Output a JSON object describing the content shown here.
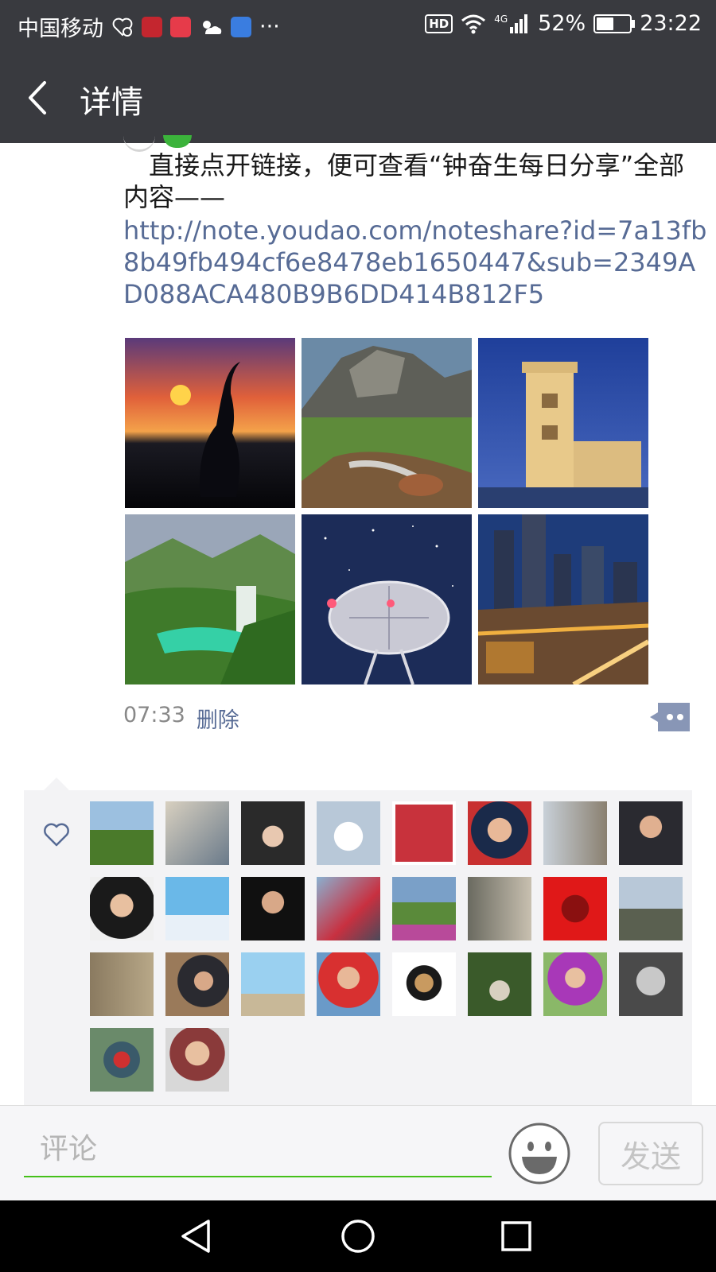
{
  "status_bar": {
    "carrier": "中国移动",
    "network": "4G",
    "battery": "52%",
    "battery_level": 0.52,
    "time": "23:22",
    "hd_label": "HD",
    "more": "···"
  },
  "header": {
    "title": "详情"
  },
  "post": {
    "text": "直接点开链接，便可查看“钟奋生每日分享”全部内容——",
    "link": "http://note.youdao.com/noteshare?id=7a13fb8b49fb494cf6e8478eb1650447&sub=2349AD088ACA480B9B6DD414B812F5",
    "time": "07:33",
    "delete_label": "删除",
    "photos": [
      "sunset-crane",
      "mountain-stream",
      "belem-tower",
      "waterfall-valley",
      "radio-telescope",
      "city-night"
    ]
  },
  "likes": {
    "icon": "heart-outline-icon",
    "avatars": 26
  },
  "comment_bar": {
    "placeholder": "评论",
    "send_label": "发送"
  },
  "colors": {
    "header_bg": "#393a3f",
    "link": "#576b95",
    "input_underline": "#45c01a"
  }
}
